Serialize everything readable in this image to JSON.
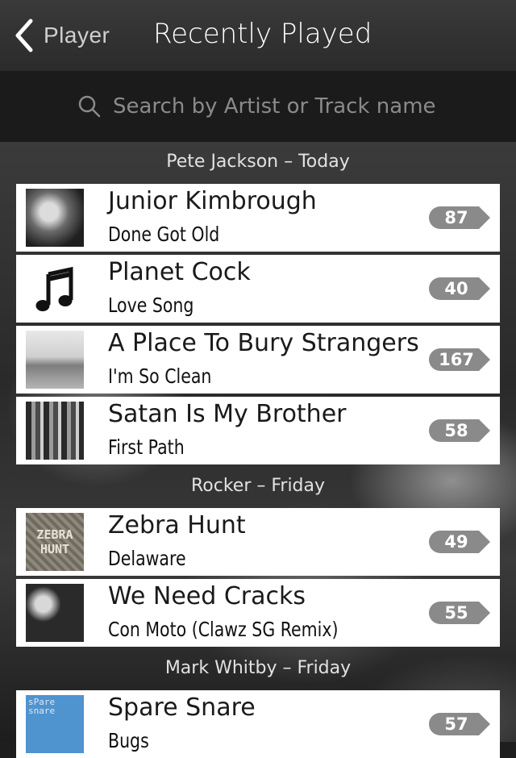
{
  "nav": {
    "back_label": "Player",
    "title": "Recently Played"
  },
  "search": {
    "placeholder": "Search by Artist or Track name"
  },
  "sections": [
    {
      "header": "Pete Jackson – Today",
      "items": [
        {
          "artist": "Junior Kimbrough",
          "track": "Done Got Old",
          "count": "87",
          "art": "photo-bw"
        },
        {
          "artist": "Planet Cock",
          "track": "Love Song",
          "count": "40",
          "art": "music-note-icon"
        },
        {
          "artist": "A Place To Bury Strangers",
          "track": "I'm So Clean",
          "count": "167",
          "art": "photo-street"
        },
        {
          "artist": "Satan Is My Brother",
          "track": "First Path",
          "count": "58",
          "art": "photo-band"
        }
      ]
    },
    {
      "header": "Rocker – Friday",
      "items": [
        {
          "artist": "Zebra Hunt",
          "track": "Delaware",
          "count": "49",
          "art": "zebra-hunt-cover",
          "art_text": "ZEBRA HUNT"
        },
        {
          "artist": "We Need Cracks",
          "track": "Con Moto (Clawz SG Remix)",
          "count": "55",
          "art": "photo-duo"
        }
      ]
    },
    {
      "header": "Mark Whitby – Friday",
      "items": [
        {
          "artist": "Spare Snare",
          "track": "Bugs",
          "count": "57",
          "art": "spare-snare-cover",
          "art_text": "sPare snare"
        }
      ]
    }
  ]
}
